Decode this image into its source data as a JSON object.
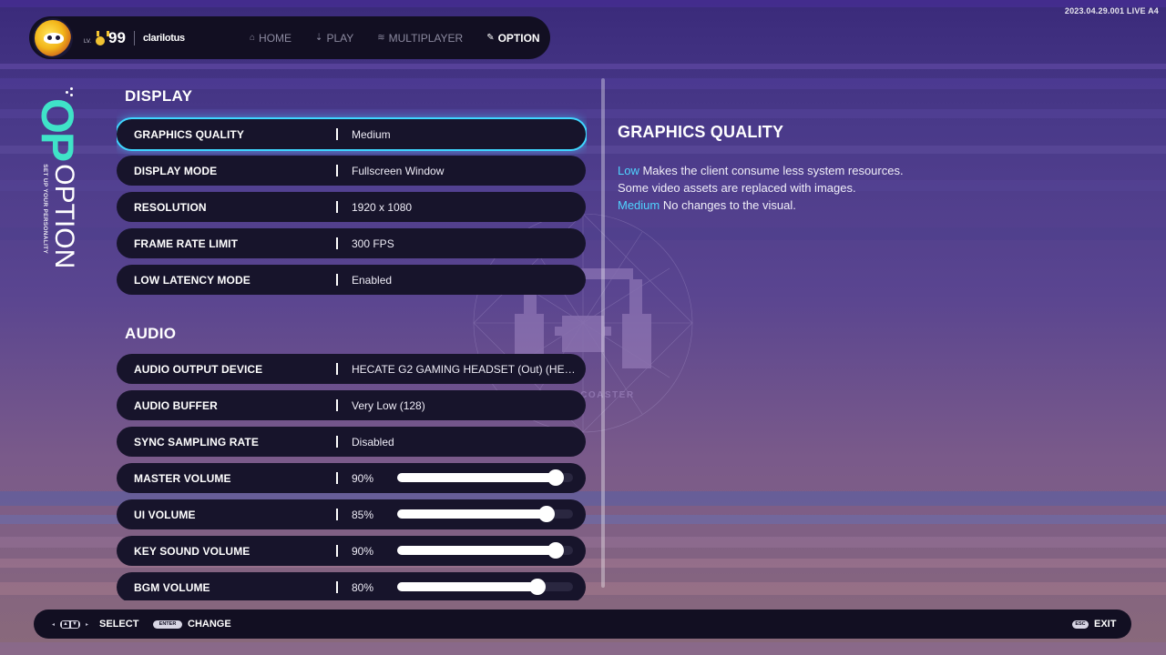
{
  "version": "2023.04.29.001 LIVE A4",
  "profile": {
    "level_prefix": "LV.",
    "level": "99",
    "username": "clarilotus"
  },
  "nav": {
    "items": [
      {
        "label": "HOME",
        "icon": "home-icon",
        "active": false
      },
      {
        "label": "PLAY",
        "icon": "play-icon",
        "active": false
      },
      {
        "label": "MULTIPLAYER",
        "icon": "signal-icon",
        "active": false
      },
      {
        "label": "OPTION",
        "icon": "wrench-icon",
        "active": true
      }
    ]
  },
  "side": {
    "short": "OP",
    "title": "OPTION",
    "subtitle": "SET UP YOUR PERSONALITY"
  },
  "sections": {
    "display": {
      "title": "DISPLAY",
      "rows": [
        {
          "label": "GRAPHICS QUALITY",
          "value": "Medium",
          "selected": true
        },
        {
          "label": "DISPLAY MODE",
          "value": "Fullscreen Window"
        },
        {
          "label": "RESOLUTION",
          "value": "1920 x 1080"
        },
        {
          "label": "FRAME RATE LIMIT",
          "value": "300 FPS"
        },
        {
          "label": "LOW LATENCY MODE",
          "value": "Enabled"
        }
      ]
    },
    "audio": {
      "title": "AUDIO",
      "rows": [
        {
          "label": "AUDIO OUTPUT DEVICE",
          "value": "HECATE G2 GAMING HEADSET (Out) (HE…"
        },
        {
          "label": "AUDIO BUFFER",
          "value": "Very Low (128)"
        },
        {
          "label": "SYNC SAMPLING RATE",
          "value": "Disabled"
        },
        {
          "label": "MASTER VOLUME",
          "value": "90%",
          "slider": 0.9
        },
        {
          "label": "UI VOLUME",
          "value": "85%",
          "slider": 0.85
        },
        {
          "label": "KEY SOUND VOLUME",
          "value": "90%",
          "slider": 0.9
        },
        {
          "label": "BGM VOLUME",
          "value": "80%",
          "slider": 0.8
        }
      ]
    }
  },
  "description": {
    "title": "GRAPHICS QUALITY",
    "line1_kw": "Low",
    "line1_text": " Makes the client consume less system resources.",
    "line2_text": "Some video assets are replaced with images.",
    "line3_kw": "Medium",
    "line3_text": " No changes to the visual."
  },
  "watermark": "GROOVE COASTER",
  "footer": {
    "select_label": "SELECT",
    "change_key": "ENTER",
    "change_label": "CHANGE",
    "exit_key": "ESC",
    "exit_label": "EXIT"
  },
  "colors": {
    "accent_cyan": "#3fd6ff",
    "title_teal": "#3fe3c8",
    "panel_dark": "#17142b"
  }
}
